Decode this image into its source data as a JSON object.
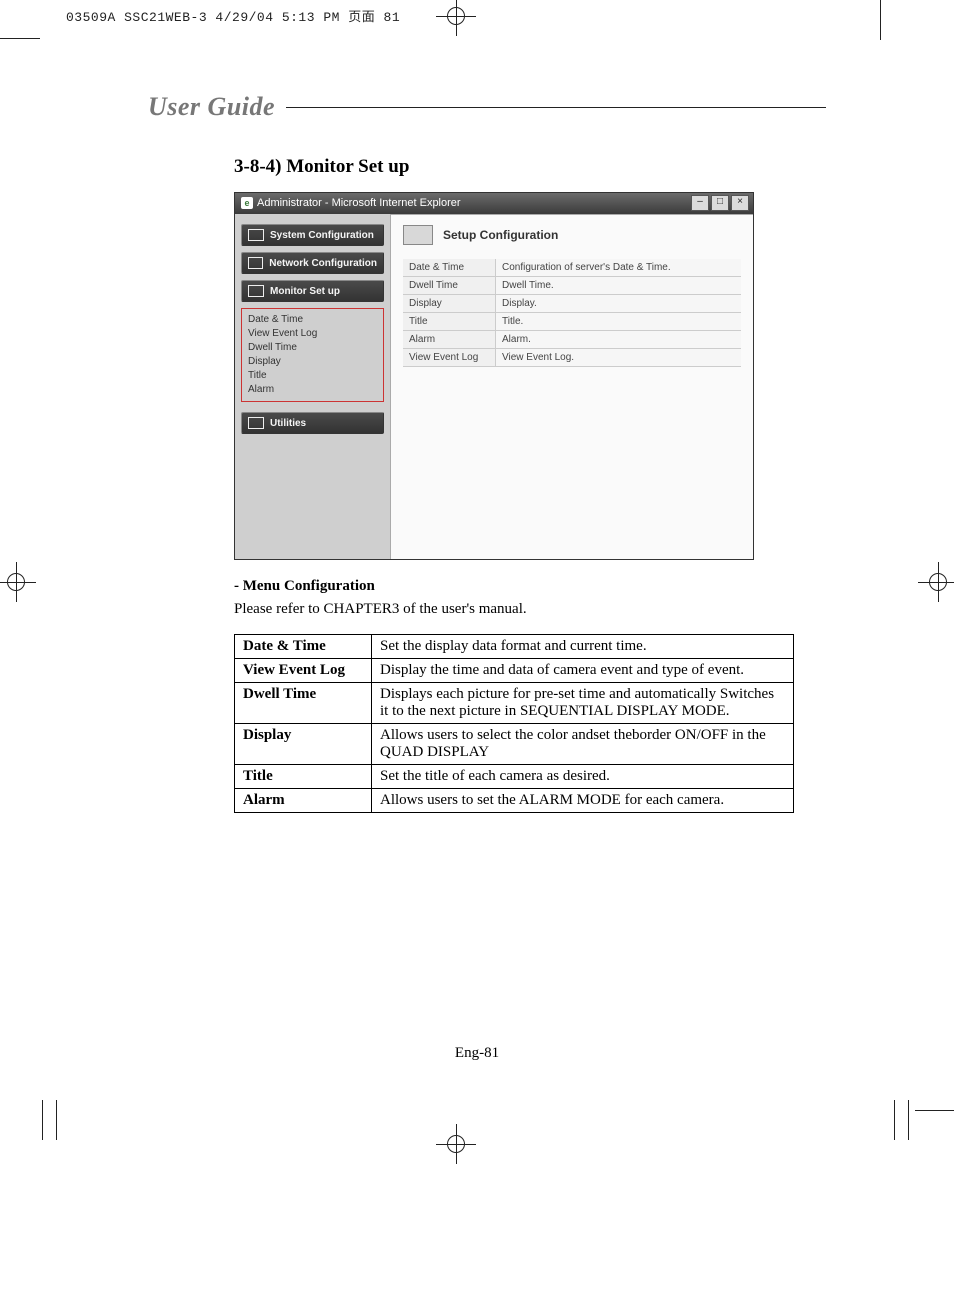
{
  "crop_header": "03509A SSC21WEB-3  4/29/04  5:13 PM  页面 81",
  "guide_label": "User Guide",
  "heading": "3-8-4) Monitor Set up",
  "ie": {
    "title": "Administrator - Microsoft Internet Explorer",
    "nav": {
      "sys": "System Configuration",
      "net": "Network Configuration",
      "mon": "Monitor Set up",
      "sub": [
        "Date & Time",
        "View Event Log",
        "Dwell Time",
        "Display",
        "Title",
        "Alarm"
      ],
      "util": "Utilities"
    },
    "pane": {
      "title": "Setup Configuration",
      "rows": [
        {
          "k": "Date & Time",
          "v": "Configuration of server's Date & Time."
        },
        {
          "k": "Dwell Time",
          "v": "Dwell Time."
        },
        {
          "k": "Display",
          "v": "Display."
        },
        {
          "k": "Title",
          "v": "Title."
        },
        {
          "k": "Alarm",
          "v": "Alarm."
        },
        {
          "k": "View Event Log",
          "v": "View Event Log."
        }
      ]
    }
  },
  "subhead": "- Menu Configuration",
  "body_p": "Please refer to CHAPTER3 of the user's manual.",
  "desc_rows": [
    {
      "k": "Date & Time",
      "v": "Set the display data format and current time."
    },
    {
      "k": "View Event Log",
      "v": "Display the time and data of camera event and type of event."
    },
    {
      "k": "Dwell Time",
      "v": "Displays each picture for pre-set time and automatically Switches it to the next picture in SEQUENTIAL DISPLAY MODE."
    },
    {
      "k": "Display",
      "v": "Allows users to select the color andset theborder ON/OFF in the QUAD DISPLAY"
    },
    {
      "k": "Title",
      "v": "Set the title of each camera as desired."
    },
    {
      "k": "Alarm",
      "v": "Allows users to set the ALARM MODE for each camera."
    }
  ],
  "footer": "Eng-81"
}
